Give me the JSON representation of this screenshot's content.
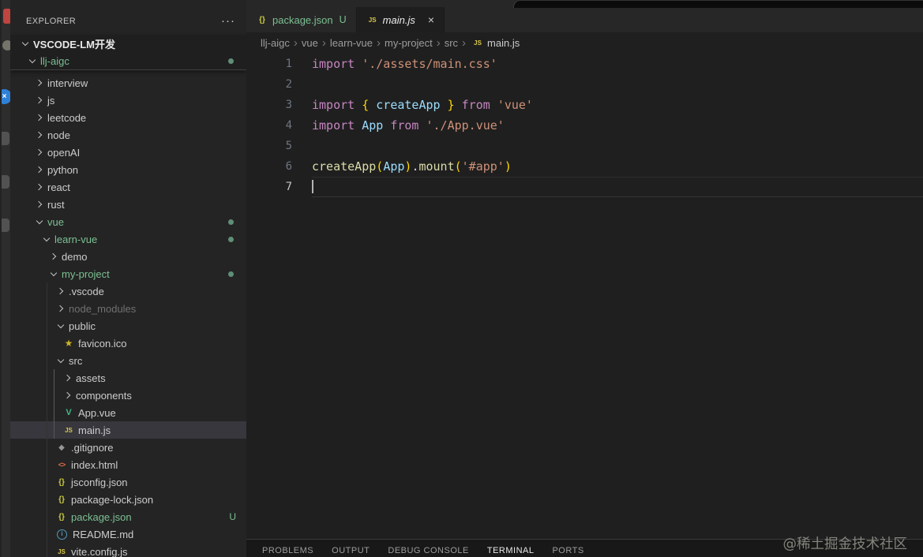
{
  "colors": {
    "git_untracked_green": "#7cc092",
    "git_dot_green": "#5f8f77",
    "js_icon_yellow": "#d9c74a",
    "json_icon_yellow": "#cbcb41",
    "vue_icon_green": "#42b883",
    "html_icon_orange": "#dd6b46",
    "info_icon_blue": "#519aba",
    "keyword_magenta": "#c586c0",
    "string_orange": "#ce9178",
    "identifier_blue": "#9cdcfe",
    "function_yellow": "#dcdcaa",
    "bracket_gold": "#ffd700",
    "selection_row": "#37373d"
  },
  "icons": {
    "js": "JS",
    "json": "{}",
    "html": "<>",
    "vue": "V",
    "star": "★",
    "git": "◆",
    "info": "i",
    "close": "×",
    "blue_badge": "×"
  },
  "activity_strip": {
    "icons": [
      "red-fragment-icon",
      "grey-circle-icon",
      "blue-x-badge-icon",
      "grey-square-icon",
      "grey-square-icon",
      "grey-square-icon"
    ]
  },
  "sidebar": {
    "title": "EXPLORER",
    "more_actions_label": "···",
    "sticky_rows": [
      {
        "label": "VSCODE-LM开发",
        "depth": 0,
        "kind": "folder",
        "expanded": true,
        "bold": true
      },
      {
        "label": "llj-aigc",
        "depth": 1,
        "kind": "folder",
        "expanded": true,
        "green": true,
        "dot": true
      }
    ],
    "tree": [
      {
        "label": "interview",
        "depth": 2,
        "kind": "folder"
      },
      {
        "label": "js",
        "depth": 2,
        "kind": "folder"
      },
      {
        "label": "leetcode",
        "depth": 2,
        "kind": "folder"
      },
      {
        "label": "node",
        "depth": 2,
        "kind": "folder"
      },
      {
        "label": "openAI",
        "depth": 2,
        "kind": "folder"
      },
      {
        "label": "python",
        "depth": 2,
        "kind": "folder"
      },
      {
        "label": "react",
        "depth": 2,
        "kind": "folder"
      },
      {
        "label": "rust",
        "depth": 2,
        "kind": "folder"
      },
      {
        "label": "vue",
        "depth": 2,
        "kind": "folder",
        "expanded": true,
        "green": true,
        "dot": true
      },
      {
        "label": "learn-vue",
        "depth": 3,
        "kind": "folder",
        "expanded": true,
        "green": true,
        "dot": true
      },
      {
        "label": "demo",
        "depth": 4,
        "kind": "folder"
      },
      {
        "label": "my-project",
        "depth": 4,
        "kind": "folder",
        "expanded": true,
        "green": true,
        "dot": true
      },
      {
        "label": ".vscode",
        "depth": 5,
        "kind": "folder"
      },
      {
        "label": "node_modules",
        "depth": 5,
        "kind": "folder",
        "dim": true
      },
      {
        "label": "public",
        "depth": 5,
        "kind": "folder",
        "expanded": true
      },
      {
        "label": "favicon.ico",
        "depth": 6,
        "kind": "file",
        "icon": "star"
      },
      {
        "label": "src",
        "depth": 5,
        "kind": "folder",
        "expanded": true
      },
      {
        "label": "assets",
        "depth": 6,
        "kind": "folder"
      },
      {
        "label": "components",
        "depth": 6,
        "kind": "folder"
      },
      {
        "label": "App.vue",
        "depth": 6,
        "kind": "file",
        "icon": "vue"
      },
      {
        "label": "main.js",
        "depth": 6,
        "kind": "file",
        "icon": "js",
        "selected": true
      },
      {
        "label": ".gitignore",
        "depth": 5,
        "kind": "file",
        "icon": "git"
      },
      {
        "label": "index.html",
        "depth": 5,
        "kind": "file",
        "icon": "html"
      },
      {
        "label": "jsconfig.json",
        "depth": 5,
        "kind": "file",
        "icon": "json"
      },
      {
        "label": "package-lock.json",
        "depth": 5,
        "kind": "file",
        "icon": "json"
      },
      {
        "label": "package.json",
        "depth": 5,
        "kind": "file",
        "icon": "json",
        "green": true,
        "badge": "U"
      },
      {
        "label": "README.md",
        "depth": 5,
        "kind": "file",
        "icon": "info"
      },
      {
        "label": "vite.config.js",
        "depth": 5,
        "kind": "file",
        "icon": "js"
      }
    ]
  },
  "tabs": [
    {
      "label": "package.json",
      "icon": "json",
      "badge": "U",
      "active": false,
      "green": true
    },
    {
      "label": "main.js",
      "icon": "js",
      "active": true,
      "italic": true,
      "close": true
    }
  ],
  "breadcrumb": {
    "path": [
      "llj-aigc",
      "vue",
      "learn-vue",
      "my-project",
      "src"
    ],
    "file": {
      "label": "main.js",
      "icon": "js"
    }
  },
  "editor": {
    "lines": [
      {
        "num": "1",
        "tokens": [
          [
            "kw",
            "import "
          ],
          [
            "str",
            "'./assets/main.css'"
          ]
        ]
      },
      {
        "num": "2",
        "tokens": []
      },
      {
        "num": "3",
        "tokens": [
          [
            "kw",
            "import "
          ],
          [
            "br",
            "{ "
          ],
          [
            "var",
            "createApp"
          ],
          [
            "br",
            " }"
          ],
          [
            "kw",
            " from "
          ],
          [
            "str",
            "'vue'"
          ]
        ]
      },
      {
        "num": "4",
        "tokens": [
          [
            "kw",
            "import "
          ],
          [
            "var",
            "App"
          ],
          [
            "kw",
            " from "
          ],
          [
            "str",
            "'./App.vue'"
          ]
        ]
      },
      {
        "num": "5",
        "tokens": []
      },
      {
        "num": "6",
        "tokens": [
          [
            "fn",
            "createApp"
          ],
          [
            "br",
            "("
          ],
          [
            "var",
            "App"
          ],
          [
            "br",
            ")"
          ],
          [
            "plain",
            "."
          ],
          [
            "fn",
            "mount"
          ],
          [
            "br",
            "("
          ],
          [
            "str",
            "'#app'"
          ],
          [
            "br",
            ")"
          ]
        ]
      },
      {
        "num": "7",
        "tokens": [],
        "current": true,
        "cursor": true
      }
    ]
  },
  "panel": {
    "tabs": [
      {
        "label": "PROBLEMS",
        "active": false
      },
      {
        "label": "OUTPUT",
        "active": false
      },
      {
        "label": "DEBUG CONSOLE",
        "active": false
      },
      {
        "label": "TERMINAL",
        "active": true
      },
      {
        "label": "PORTS",
        "active": false
      }
    ]
  },
  "watermark": {
    "text": "@稀土掘金技术社区"
  }
}
